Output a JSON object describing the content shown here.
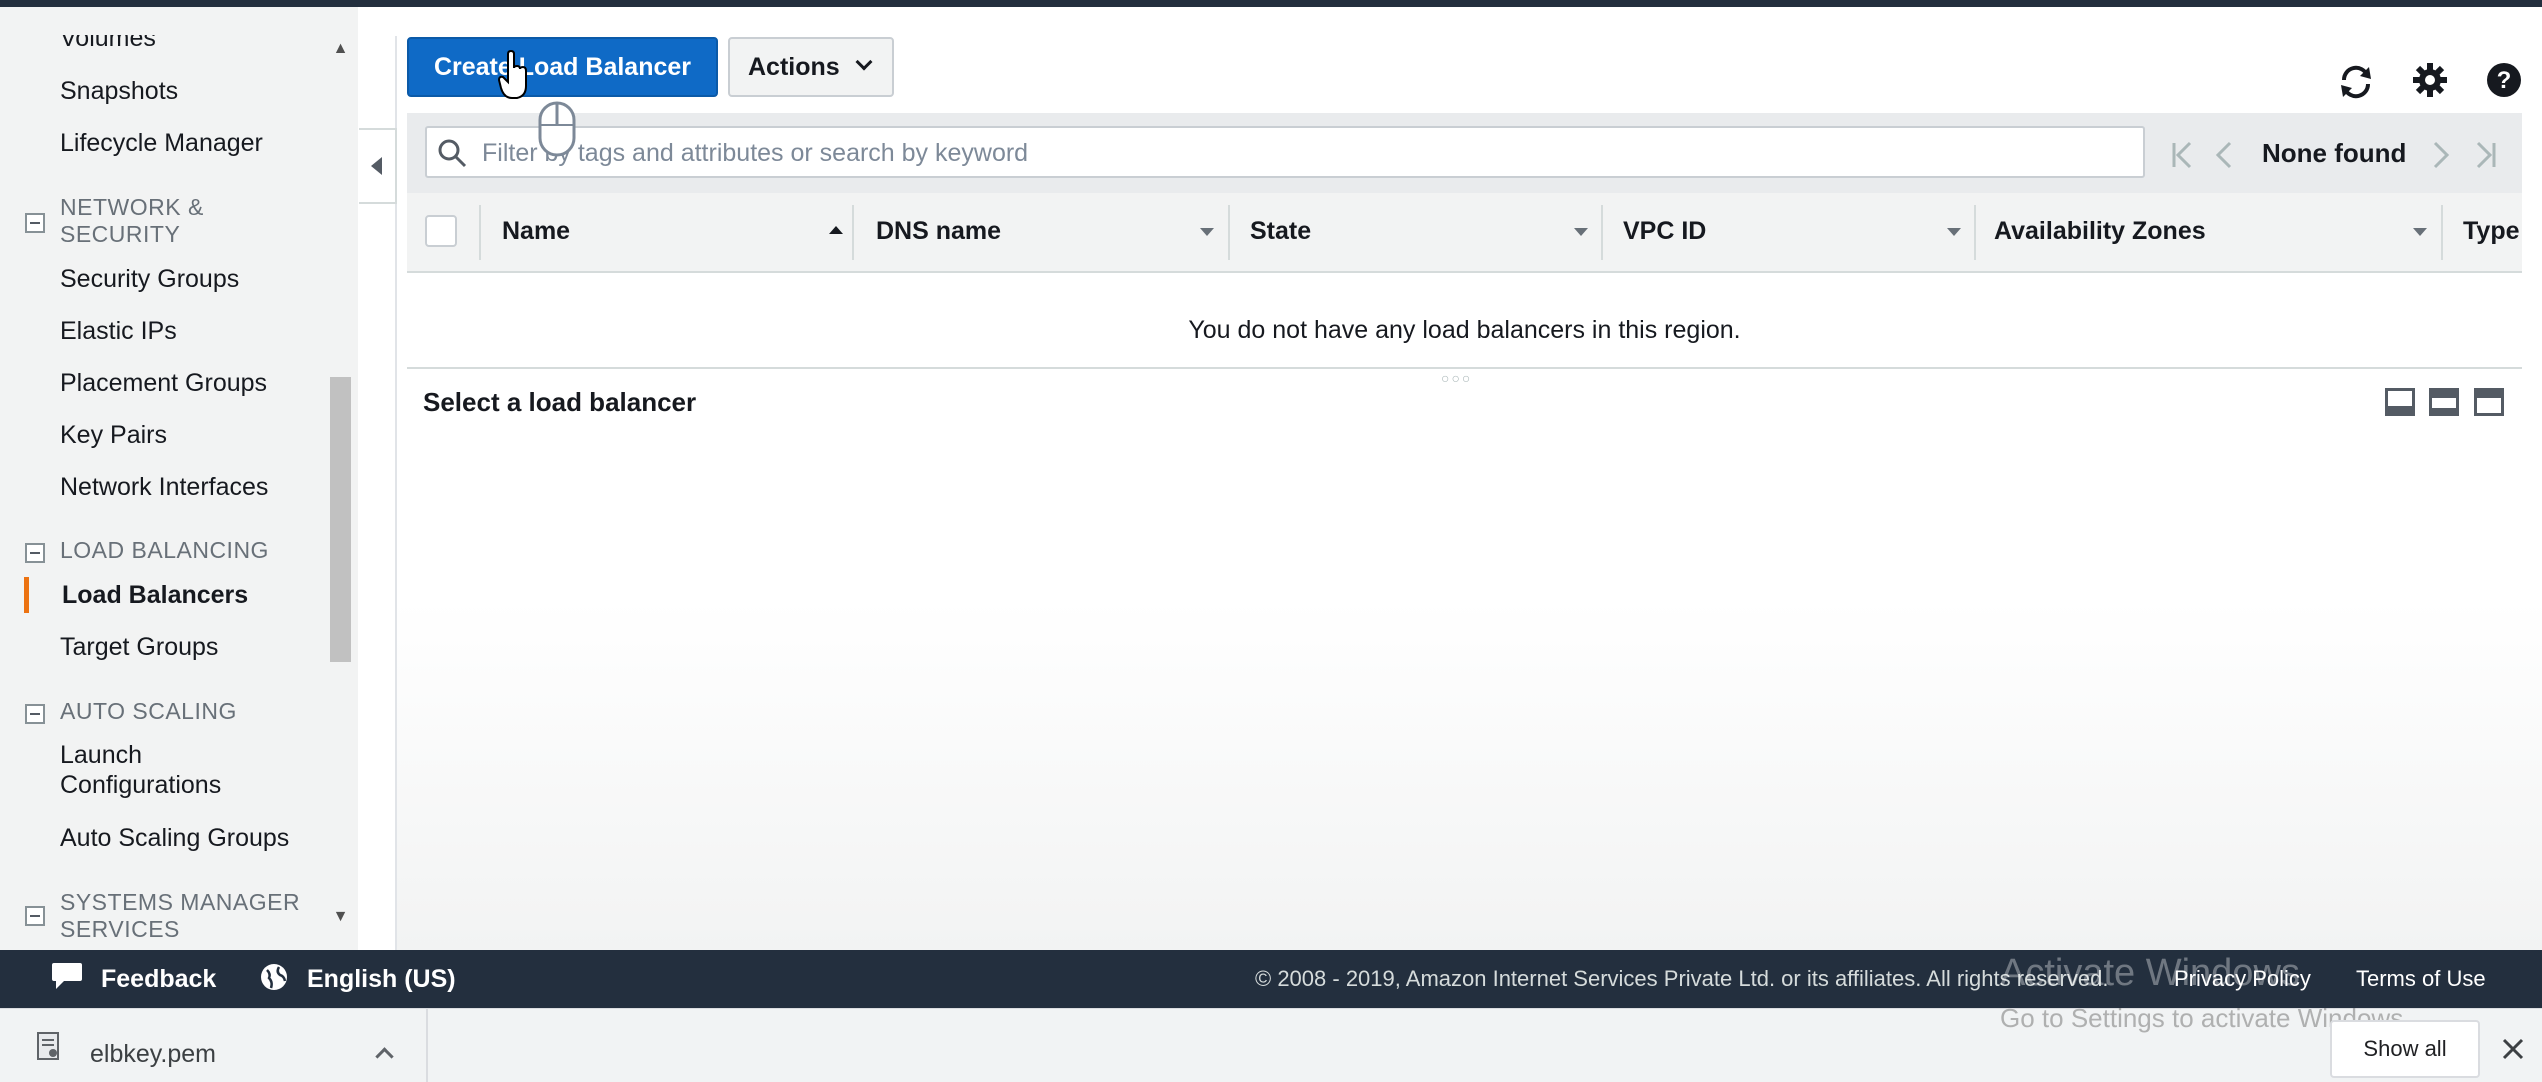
{
  "sidebar": {
    "items_top": [
      {
        "label": "Volumes"
      },
      {
        "label": "Snapshots"
      },
      {
        "label": "Lifecycle Manager"
      }
    ],
    "sections": [
      {
        "label_line1": "NETWORK &",
        "label_line2": "SECURITY"
      },
      {
        "label_line1": "LOAD BALANCING"
      },
      {
        "label_line1": "AUTO SCALING"
      },
      {
        "label_line1": "SYSTEMS MANAGER",
        "label_line2": "SERVICES"
      }
    ],
    "network_items": [
      {
        "label": "Security Groups"
      },
      {
        "label": "Elastic IPs"
      },
      {
        "label": "Placement Groups"
      },
      {
        "label": "Key Pairs"
      },
      {
        "label": "Network Interfaces"
      }
    ],
    "lb_items": [
      {
        "label": "Load Balancers",
        "active": true
      },
      {
        "label": "Target Groups"
      }
    ],
    "as_items": [
      {
        "label_line1": "Launch",
        "label_line2": "Configurations"
      },
      {
        "label": "Auto Scaling Groups"
      }
    ]
  },
  "toolbar": {
    "create_label": "Create Load Balancer",
    "actions_label": "Actions",
    "icons": [
      "refresh-icon",
      "gear-icon",
      "help-icon"
    ]
  },
  "filter": {
    "placeholder": "Filter by tags and attributes or search by keyword",
    "pager_text": "None found"
  },
  "table": {
    "columns": [
      "Name",
      "DNS name",
      "State",
      "VPC ID",
      "Availability Zones",
      "Type"
    ],
    "empty_message": "You do not have any load balancers in this region."
  },
  "detail_pane": {
    "title": "Select a load balancer"
  },
  "footer": {
    "feedback": "Feedback",
    "language": "English (US)",
    "copyright": "© 2008 - 2019, Amazon Internet Services Private Ltd. or its affiliates. All rights reserved.",
    "privacy": "Privacy Policy",
    "terms": "Terms of Use",
    "watermark_line1": "Activate Windows",
    "watermark_line2": "Go to Settings to activate Windows."
  },
  "downloads": {
    "file_name": "elbkey.pem",
    "show_all": "Show all"
  },
  "colors": {
    "primary_button": "#0f6ac6",
    "footer_bg": "#232f3e",
    "active_indicator": "#ec7211"
  }
}
